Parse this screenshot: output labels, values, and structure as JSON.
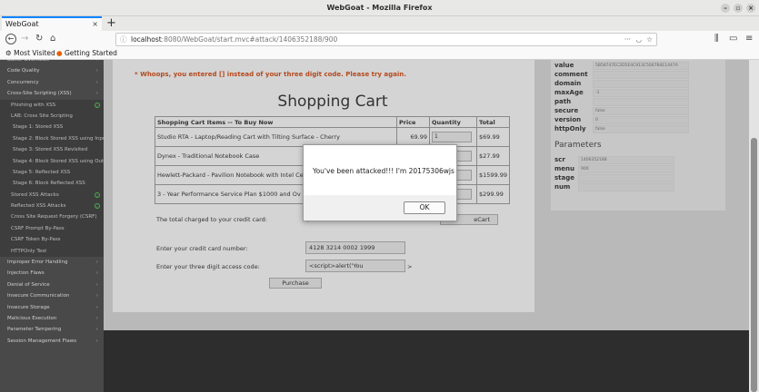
{
  "window": {
    "title": "WebGoat - Mozilla Firefox"
  },
  "tabs": [
    {
      "label": "WebGoat"
    }
  ],
  "address": {
    "host": "localhost",
    "path": ":8080/WebGoat/start.mvc#attack/1406352188/900"
  },
  "bookmarks": [
    {
      "label": "Most Visited"
    },
    {
      "label": "Getting Started"
    }
  ],
  "sidebar": {
    "items": [
      {
        "label": "Buffer Overflows",
        "type": "cat"
      },
      {
        "label": "Code Quality",
        "type": "cat"
      },
      {
        "label": "Concurrency",
        "type": "cat"
      },
      {
        "label": "Cross-Site Scripting (XSS)",
        "type": "cat"
      },
      {
        "label": "Phishing with XSS",
        "type": "sub",
        "done": true
      },
      {
        "label": "LAB: Cross Site Scripting",
        "type": "sub"
      },
      {
        "label": "Stage 1: Stored XSS",
        "type": "sub2"
      },
      {
        "label": "Stage 2: Block Stored XSS using Input Validation",
        "type": "sub2"
      },
      {
        "label": "Stage 3: Stored XSS Revisited",
        "type": "sub2"
      },
      {
        "label": "Stage 4: Block Stored XSS using Output Encoding",
        "type": "sub2"
      },
      {
        "label": "Stage 5: Reflected XSS",
        "type": "sub2"
      },
      {
        "label": "Stage 6: Block Reflected XSS",
        "type": "sub2"
      },
      {
        "label": "Stored XSS Attacks",
        "type": "sub",
        "done": true
      },
      {
        "label": "Reflected XSS Attacks",
        "type": "sub",
        "done": true
      },
      {
        "label": "Cross Site Request Forgery (CSRF)",
        "type": "sub"
      },
      {
        "label": "CSRF Prompt By-Pass",
        "type": "sub"
      },
      {
        "label": "CSRF Token By-Pass",
        "type": "sub"
      },
      {
        "label": "HTTPOnly Test",
        "type": "sub"
      },
      {
        "label": "Improper Error Handling",
        "type": "cat"
      },
      {
        "label": "Injection Flaws",
        "type": "cat"
      },
      {
        "label": "Denial of Service",
        "type": "cat"
      },
      {
        "label": "Insecure Communication",
        "type": "cat"
      },
      {
        "label": "Insecure Storage",
        "type": "cat"
      },
      {
        "label": "Malicious Execution",
        "type": "cat"
      },
      {
        "label": "Parameter Tampering",
        "type": "cat"
      },
      {
        "label": "Session Management Flaws",
        "type": "cat"
      }
    ]
  },
  "lesson": {
    "whoops": "* Whoops, you entered [] instead of your three digit code. Please try again.",
    "title": "Shopping Cart",
    "headers": [
      "Shopping Cart Items -- To Buy Now",
      "Price",
      "Quantity",
      "Total"
    ],
    "rows": [
      {
        "item": "Studio RTA - Laptop/Reading Cart with Tilting Surface - Cherry",
        "price": "69.99",
        "qty": "1",
        "total": "$69.99"
      },
      {
        "item": "Dynex - Traditional Notebook Case",
        "price": "",
        "qty": "",
        "total": "$27.99"
      },
      {
        "item": "Hewlett-Packard - Pavilion Notebook with Intel Ce",
        "price": "",
        "qty": "",
        "total": "$1599.99"
      },
      {
        "item": "3 - Year Performance Service Plan $1000 and Ov",
        "price": "",
        "qty": "",
        "total": "$299.99"
      }
    ],
    "total_label": "The total charged to your credit card:",
    "total_value": "$",
    "update_button": "eCart",
    "card_label": "Enter your credit card number:",
    "card_value": "4128 3214 0002 1999",
    "code_label": "Enter your three digit access code:",
    "code_value": "<script>alert('You",
    "code_suffix": ">",
    "purchase_button": "Purchase"
  },
  "cookies": {
    "rows": [
      {
        "key": "value",
        "val": "5B58747EC2D5E4C913C5067B4E1447A"
      },
      {
        "key": "comment",
        "val": ""
      },
      {
        "key": "domain",
        "val": ""
      },
      {
        "key": "maxAge",
        "val": "-1"
      },
      {
        "key": "path",
        "val": ""
      },
      {
        "key": "secure",
        "val": "false"
      },
      {
        "key": "version",
        "val": "0"
      },
      {
        "key": "httpOnly",
        "val": "false"
      }
    ],
    "params_title": "Parameters",
    "params": [
      {
        "key": "scr",
        "val": "1406352188"
      },
      {
        "key": "menu",
        "val": "900"
      },
      {
        "key": "stage",
        "val": ""
      },
      {
        "key": "num",
        "val": ""
      }
    ]
  },
  "dialog": {
    "message": "You've been attacked!!! I'm 20175306wjs",
    "ok_label": "OK"
  }
}
